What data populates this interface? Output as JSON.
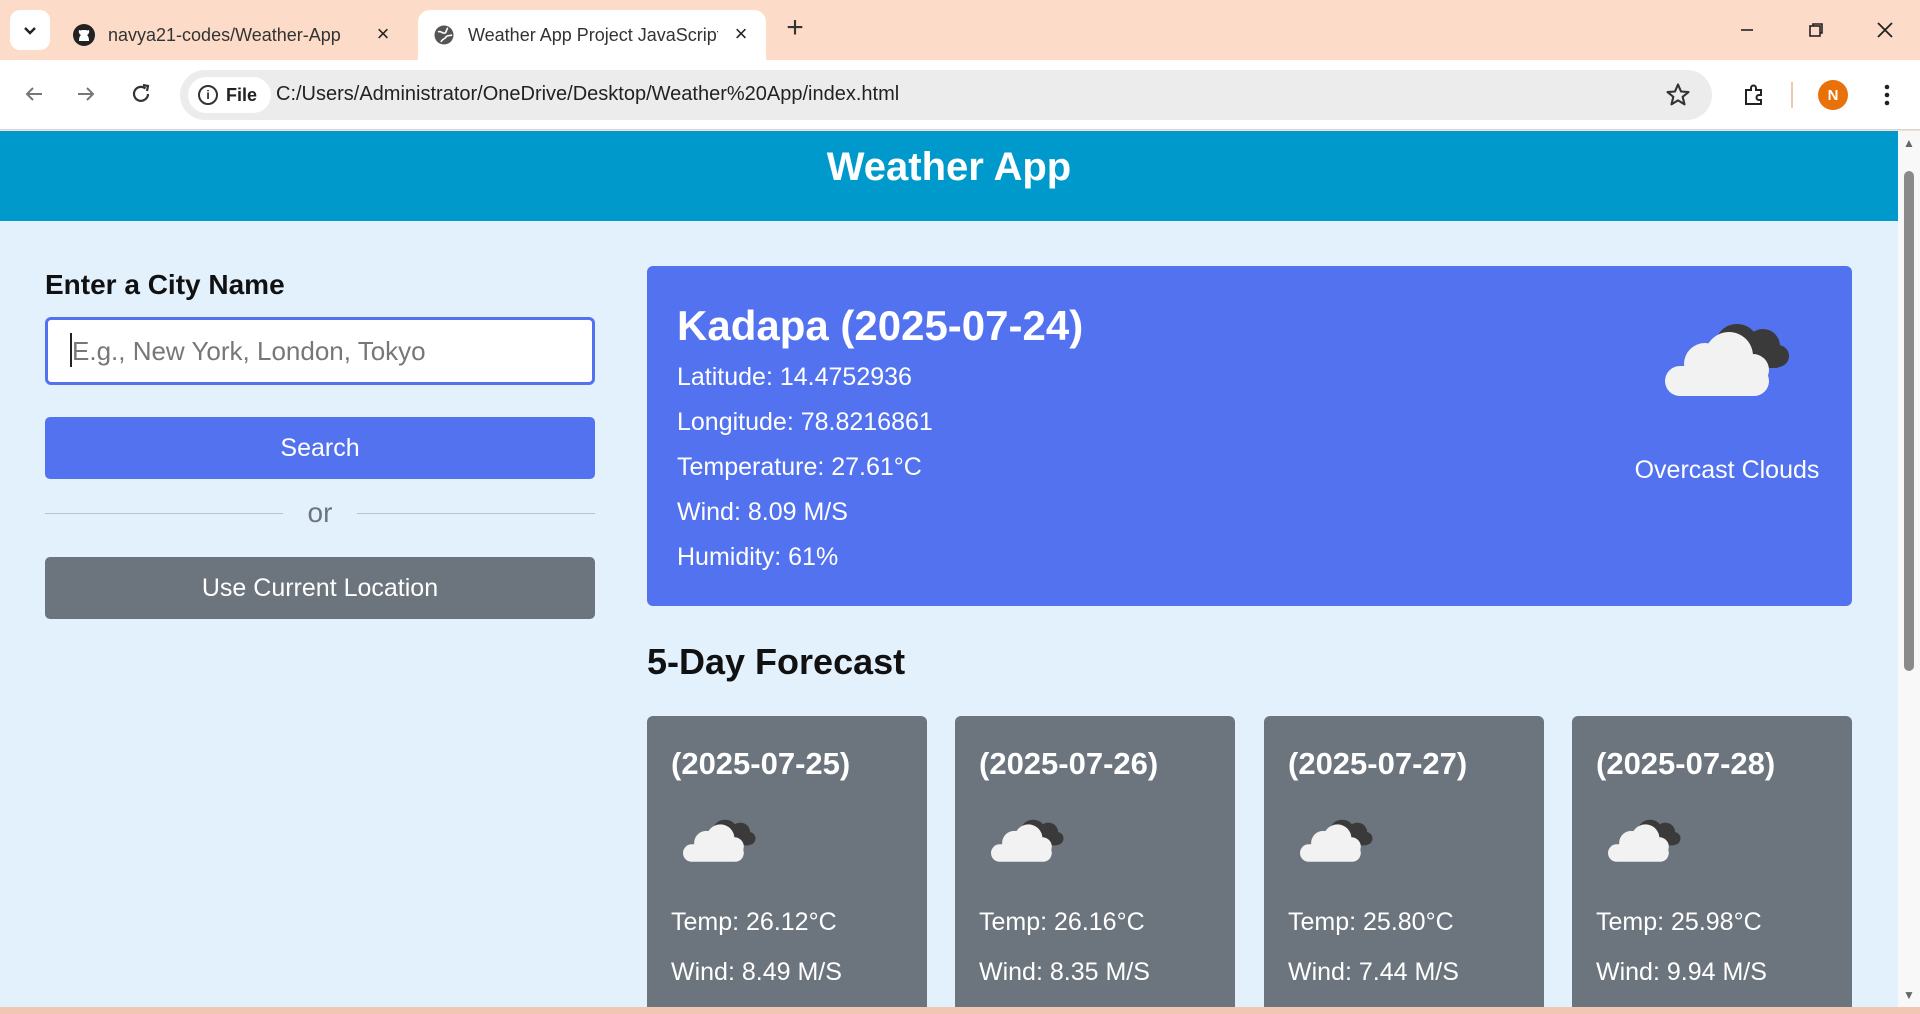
{
  "browser": {
    "tabs": [
      {
        "title": "navya21-codes/Weather-App",
        "icon": "github-icon",
        "active": false
      },
      {
        "title": "Weather App Project JavaScript",
        "icon": "globe-icon",
        "active": true
      }
    ],
    "chip_label": "File",
    "url": "C:/Users/Administrator/OneDrive/Desktop/Weather%20App/index.html",
    "profile_initial": "N",
    "accent": "#fcdcc8"
  },
  "page": {
    "header_title": "Weather App",
    "header_color": "#0099cc",
    "sidebar": {
      "heading": "Enter a City Name",
      "input_placeholder": "E.g., New York, London, Tokyo",
      "input_value": "",
      "search_label": "Search",
      "divider_text": "or",
      "location_label": "Use Current Location"
    },
    "current": {
      "title": "Kadapa (2025-07-24)",
      "latitude": "Latitude: 14.4752936",
      "longitude": "Longitude: 78.8216861",
      "temperature": "Temperature: 27.61°C",
      "wind": "Wind: 8.09 M/S",
      "humidity": "Humidity: 61%",
      "condition": "Overcast Clouds",
      "icon": "overcast-clouds-icon",
      "card_color": "#5372f0"
    },
    "forecast_title": "5-Day Forecast",
    "forecast": [
      {
        "date": "(2025-07-25)",
        "temp": "Temp: 26.12°C",
        "wind": "Wind: 8.49 M/S",
        "icon": "overcast-clouds-icon"
      },
      {
        "date": "(2025-07-26)",
        "temp": "Temp: 26.16°C",
        "wind": "Wind: 8.35 M/S",
        "icon": "overcast-clouds-icon"
      },
      {
        "date": "(2025-07-27)",
        "temp": "Temp: 25.80°C",
        "wind": "Wind: 7.44 M/S",
        "icon": "overcast-clouds-icon"
      },
      {
        "date": "(2025-07-28)",
        "temp": "Temp: 25.98°C",
        "wind": "Wind: 9.94 M/S",
        "icon": "overcast-clouds-icon"
      }
    ]
  }
}
